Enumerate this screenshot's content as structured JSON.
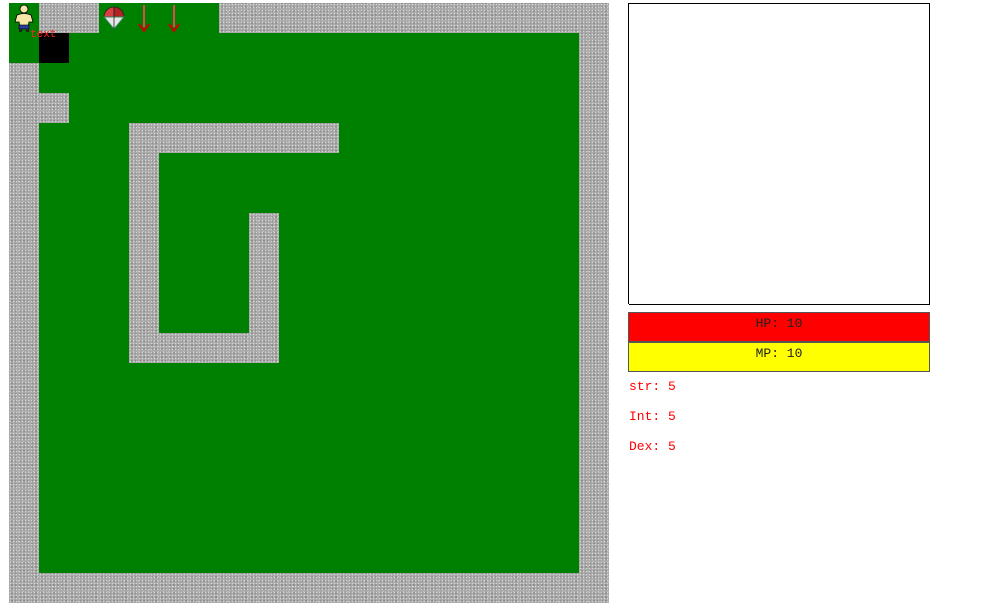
{
  "map": {
    "rows": [
      "PWWSAAFWWWWWWWWWWWWW",
      "FDFFFFFFFFFFFFFFFFFW",
      "WFFFFFFFFFFFFFFFFFFW",
      "WWFFFFFFFFFFFFFFFFFW",
      "WFFFWWWWWWWFFFFFFFFW",
      "WFFFWFFFFFFFFFFFFFFW",
      "WFFFWFFFFFFFFFFFFFFW",
      "WFFFWFFFWFFFFFFFFFFW",
      "WFFFWFFFWFFFFFFFFFFW",
      "WFFFWFFFWFFFFFFFFFFW",
      "WFFFWFFFWFFFFFFFFFFW",
      "WFFFWWWWWFFFFFFFFFFW",
      "WFFFFFFFFFFFFFFFFFFW",
      "WFFFFFFFFFFFFFFFFFFW",
      "WFFFFFFFFFFFFFFFFFFW",
      "WFFFFFFFFFFFFFFFFFFW",
      "WFFFFFFFFFFFFFFFFFFW",
      "WFFFFFFFFFFFFFFFFFFW",
      "WFFFFFFFFFFFFFFFFFFW",
      "WWWWWWWWWWWWWWWWWWWW"
    ],
    "legend": {
      "W": "stone-wall",
      "F": "grass-floor",
      "D": "dark-tile",
      "P": "player",
      "S": "shield",
      "A": "arrow"
    },
    "label": "text"
  },
  "inventory": {
    "rows": 10,
    "cols": 10
  },
  "stats": {
    "hp_text": "HP: 10",
    "mp_text": "MP: 10",
    "str_text": "str: 5",
    "int_text": "Int: 5",
    "dex_text": "Dex: 5"
  },
  "colors": {
    "floor": "#008000",
    "hp_bar": "#ff0000",
    "mp_bar": "#ffff00",
    "stat_text": "#ff0000"
  }
}
